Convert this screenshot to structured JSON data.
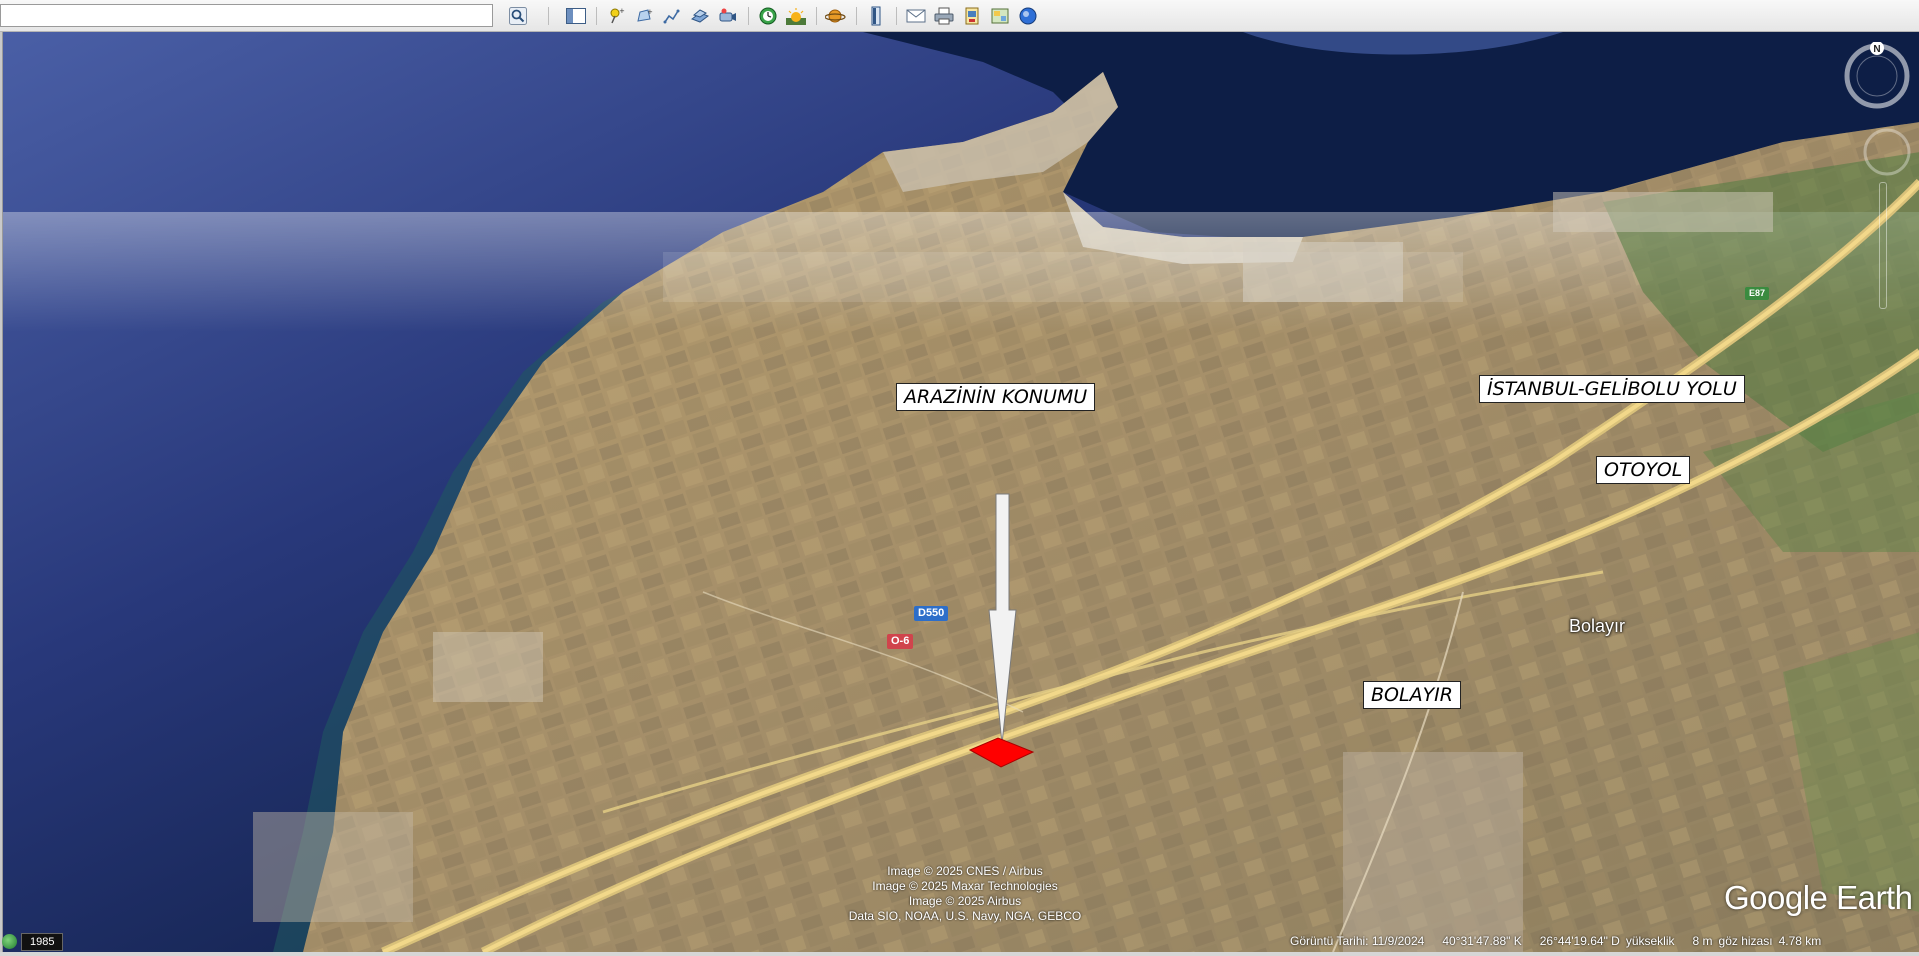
{
  "toolbar": {
    "search_placeholder": "",
    "buttons": [
      {
        "name": "search-button",
        "icon": "magnifier-icon"
      },
      {
        "name": "sidebar-toggle-button",
        "icon": "sidebar-icon"
      },
      {
        "name": "add-placemark-button",
        "icon": "pushpin-icon"
      },
      {
        "name": "add-polygon-button",
        "icon": "polygon-icon"
      },
      {
        "name": "add-path-button",
        "icon": "path-icon"
      },
      {
        "name": "add-image-overlay-button",
        "icon": "overlay-icon"
      },
      {
        "name": "record-tour-button",
        "icon": "tour-icon"
      },
      {
        "name": "historical-imagery-button",
        "icon": "clock-icon"
      },
      {
        "name": "sunlight-button",
        "icon": "sun-icon"
      },
      {
        "name": "planets-button",
        "icon": "planet-icon"
      },
      {
        "name": "ruler-button",
        "icon": "ruler-icon"
      },
      {
        "name": "email-button",
        "icon": "envelope-icon"
      },
      {
        "name": "print-button",
        "icon": "printer-icon"
      },
      {
        "name": "save-image-button",
        "icon": "save-image-icon"
      },
      {
        "name": "view-in-maps-button",
        "icon": "map-icon"
      },
      {
        "name": "earth-view-button",
        "icon": "globe-icon"
      }
    ]
  },
  "map": {
    "labels": {
      "arazi": "ARAZİNİN KONUMU",
      "road": "İSTANBUL-GELİBOLU YOLU",
      "otoyol": "OTOYOL",
      "village": "BOLAYIR"
    },
    "road_shields": {
      "d550": "D550",
      "o6": "O-6",
      "e87": "E87"
    },
    "place_name": "Bolayır",
    "attribution": [
      "Image © 2025 CNES / Airbus",
      "Image © 2025 Maxar Technologies",
      "Image © 2025 Airbus",
      "Data SIO, NOAA, U.S. Navy, NGA, GEBCO"
    ],
    "logo": "Google Earth",
    "compass_north": "N",
    "parcel_color": "#ff0000"
  },
  "status": {
    "year": "1985",
    "imagery_date": "Görüntü Tarihi: 11/9/2024",
    "latitude": "40°31'47.88\" K",
    "longitude": "26°44'19.64\" D",
    "elevation_label": "yükseklik",
    "elevation_value": "8 m",
    "eye_label": "göz hizası",
    "eye_value": "4.78 km"
  }
}
